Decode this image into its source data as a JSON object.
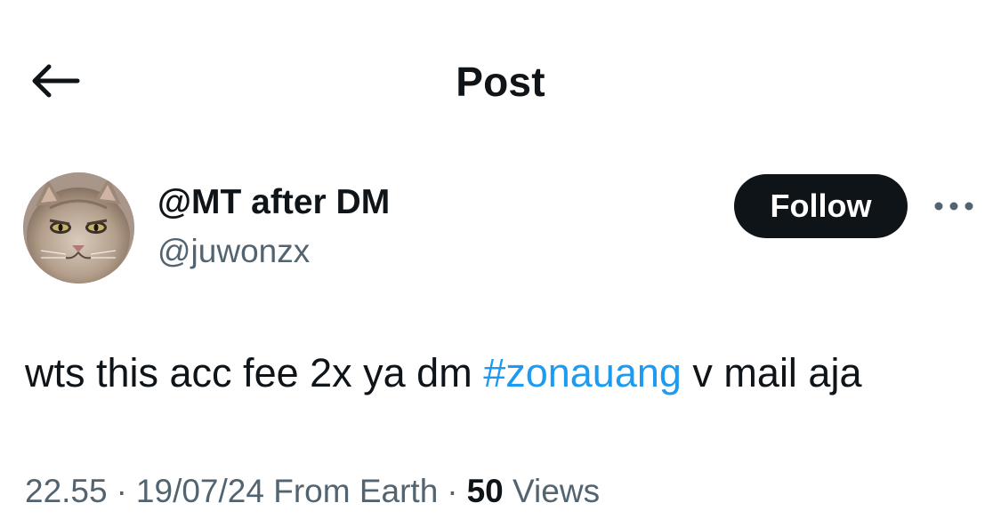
{
  "header": {
    "title": "Post",
    "back_icon": "arrow-left-icon"
  },
  "author": {
    "display_name": "@MT after DM",
    "handle": "@juwonzx",
    "avatar_icon": "cat-avatar"
  },
  "actions": {
    "follow_label": "Follow",
    "more_icon": "more-horizontal-icon"
  },
  "post": {
    "text_before": "wts this acc fee 2x ya dm ",
    "hashtag": "#zonauang",
    "text_after": " v mail aja"
  },
  "meta": {
    "time": "22.55",
    "separator": "·",
    "date": "19/07/24",
    "source": "From Earth",
    "views_count": "50",
    "views_label": "Views"
  },
  "colors": {
    "text": "#0f1419",
    "secondary": "#536471",
    "link": "#1d9bf0",
    "follow_bg": "#0f1419"
  }
}
